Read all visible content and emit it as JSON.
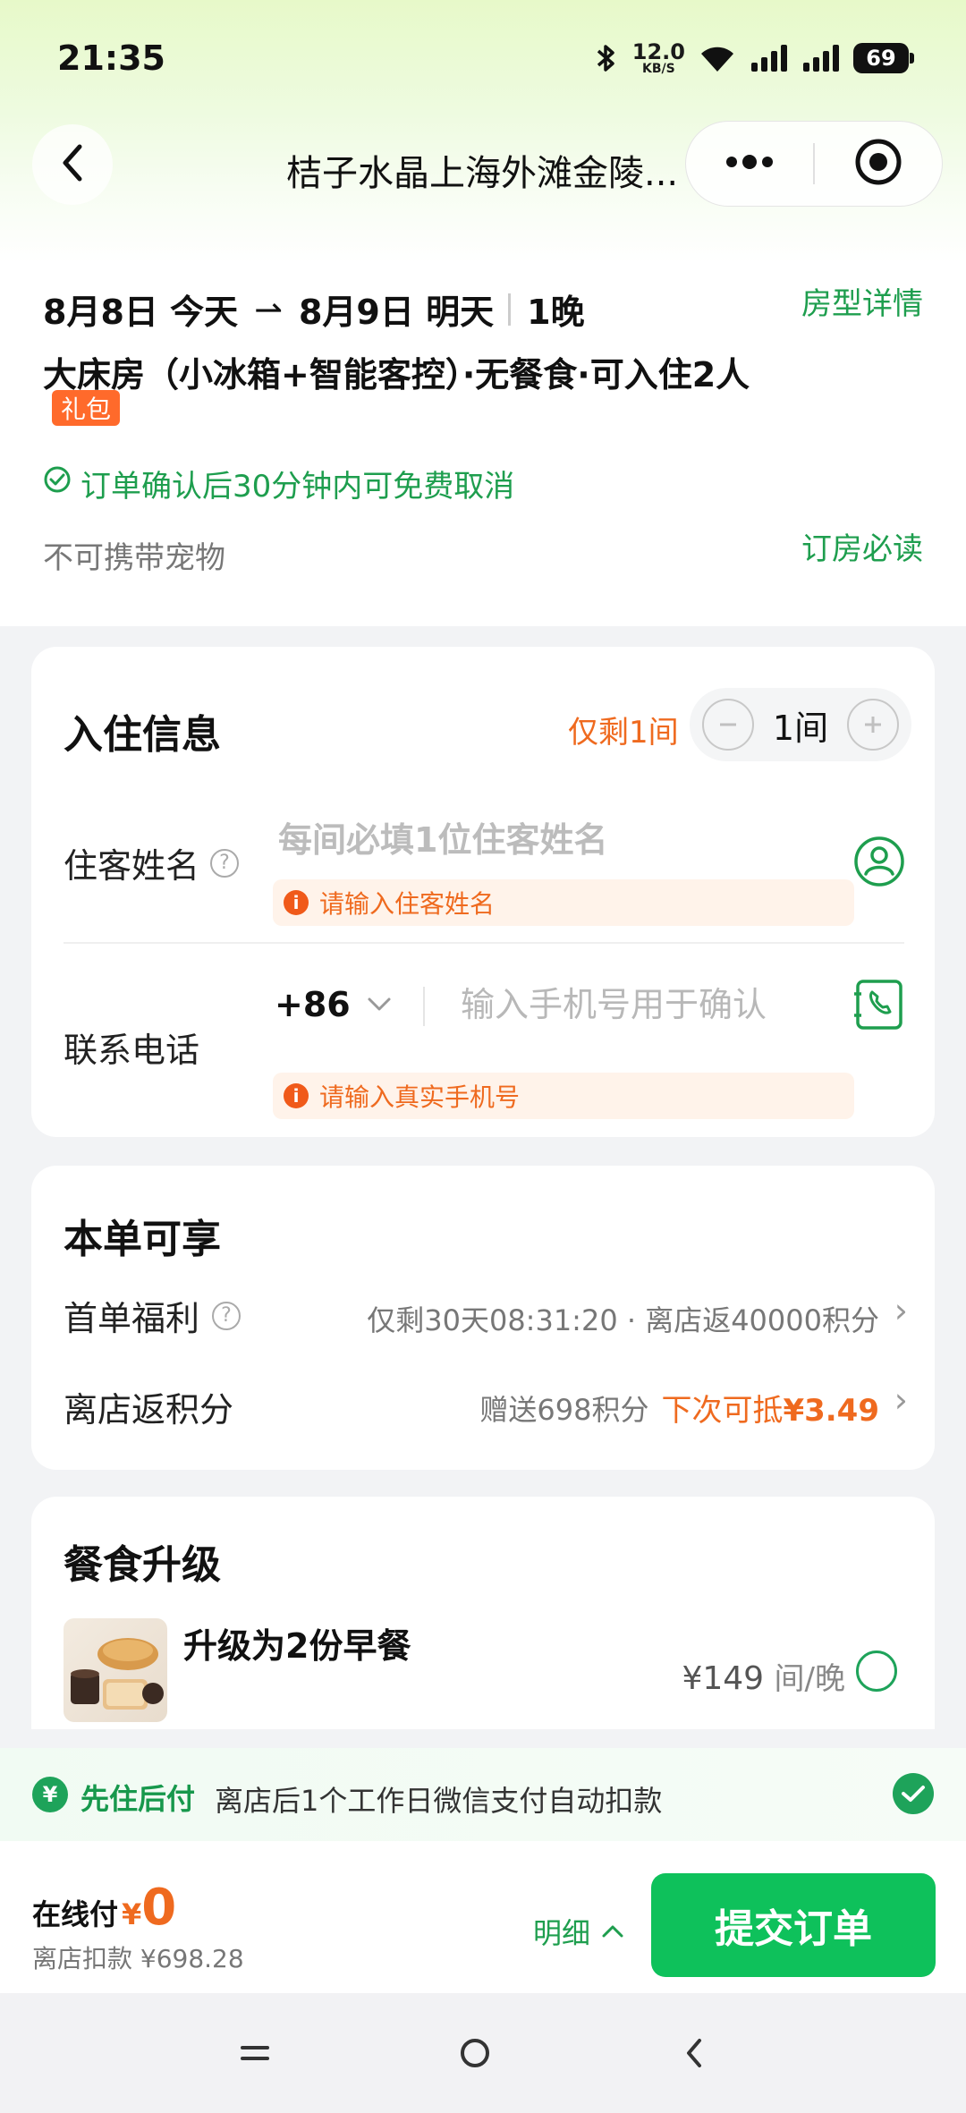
{
  "status_bar": {
    "time": "21:35",
    "net_speed_value": "12.0",
    "net_speed_unit": "KB/S",
    "battery": "69",
    "icons": [
      "bluetooth-icon",
      "wifi-icon",
      "signal-icon",
      "signal-icon"
    ]
  },
  "nav": {
    "title": "桔子水晶上海外滩金陵...",
    "back_icon": "chevron-left-icon",
    "more_icon": "more-dots-icon",
    "close_icon": "target-icon"
  },
  "booking": {
    "checkin_date": "8月8日",
    "checkin_day": "今天",
    "arrow": "⇀",
    "checkout_date": "8月9日",
    "checkout_day": "明天",
    "nights": "1晚",
    "room_detail_link": "房型详情",
    "room_name": "大床房（小冰箱+智能客控）·无餐食·可入住2人",
    "gift_badge": "礼包",
    "cancel_policy": "订单确认后30分钟内可免费取消",
    "pet_policy": "不可携带宠物",
    "booking_notes_link": "订房必读"
  },
  "checkin_info": {
    "title": "入住信息",
    "remaining": "仅剩1间",
    "room_count": "1间",
    "guest_label": "住客姓名",
    "guest_placeholder": "每间必填1位住客姓名",
    "guest_warning": "请输入住客姓名",
    "phone_label": "联系电话",
    "country_code": "+86",
    "phone_placeholder": "输入手机号用于确认",
    "phone_warning": "请输入真实手机号"
  },
  "benefits": {
    "title": "本单可享",
    "rows": [
      {
        "label": "首单福利",
        "value": "仅剩30天08:31:20 · 离店返40000积分"
      },
      {
        "label": "离店返积分",
        "value": "赠送698积分",
        "highlight_prefix": "下次可抵",
        "highlight_amount": "¥3.49"
      }
    ]
  },
  "meal_upgrade": {
    "title": "餐食升级",
    "item_name": "升级为2份早餐",
    "price": "¥149",
    "unit": "间/晚"
  },
  "pay_later": {
    "title": "先住后付",
    "description": "离店后1个工作日微信支付自动扣款",
    "icon": "yuan-icon"
  },
  "footer": {
    "online_label": "在线付",
    "currency": "¥",
    "online_amount": "0",
    "offline_text": "离店扣款 ¥698.28",
    "detail_link": "明细",
    "submit_label": "提交订单"
  },
  "colors": {
    "brand_green": "#0ec15b",
    "link_green": "#1e9e4e",
    "warning_orange": "#ef6a1f"
  }
}
